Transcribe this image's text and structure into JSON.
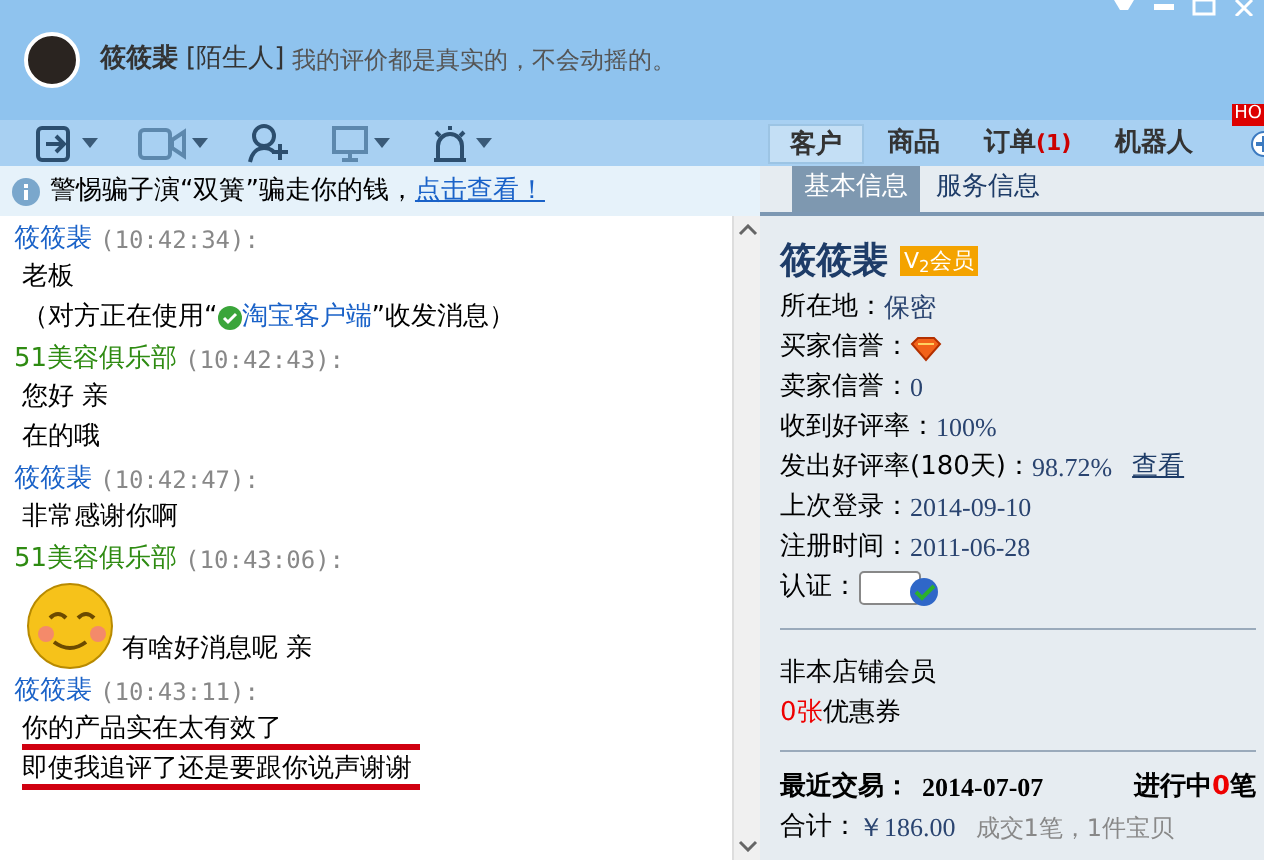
{
  "header": {
    "name": "筱筱裴",
    "relation": "[陌生人]",
    "signature": "我的评价都是真实的，不会动摇的。"
  },
  "top_tabs": [
    {
      "label": "客户",
      "selected": true
    },
    {
      "label": "商品",
      "selected": false
    },
    {
      "label": "订单",
      "badge": "(1)",
      "selected": false
    },
    {
      "label": "机器人",
      "selected": false
    }
  ],
  "hot_badge": "HO",
  "notice": {
    "text": "警惕骗子演“双簧”骗走你的钱，",
    "link": "点击查看！"
  },
  "messages": [
    {
      "sender": "筱筱裴",
      "kind": "customer",
      "time": "(10:42:34):",
      "lines": [
        {
          "text": "老板",
          "underlined": false
        }
      ],
      "client_note": {
        "before": "（对方正在使用“",
        "link": "淘宝客户端",
        "after": "”收发消息）"
      }
    },
    {
      "sender": "51美容俱乐部",
      "kind": "seller",
      "time": "(10:42:43):",
      "lines": [
        {
          "text": "您好 亲",
          "underlined": false
        },
        {
          "text": "在的哦",
          "underlined": false
        }
      ]
    },
    {
      "sender": "筱筱裴",
      "kind": "customer",
      "time": "(10:42:47):",
      "lines": [
        {
          "text": "非常感谢你啊",
          "underlined": false
        }
      ]
    },
    {
      "sender": "51美容俱乐部",
      "kind": "seller",
      "time": "(10:43:06):",
      "emoticon": true,
      "lines": [
        {
          "text": "有啥好消息呢  亲",
          "underlined": false
        }
      ]
    },
    {
      "sender": "筱筱裴",
      "kind": "customer",
      "time": "(10:43:11):",
      "lines": [
        {
          "text": "你的产品实在太有效了",
          "underlined": true
        },
        {
          "text": "即使我追评了还是要跟你说声谢谢",
          "underlined": true
        }
      ]
    }
  ],
  "info_tabs": [
    {
      "label": "基本信息",
      "selected": true
    },
    {
      "label": "服务信息",
      "selected": false
    }
  ],
  "profile": {
    "name": "筱筱裴",
    "vip": "V$_{2}$会员"
  },
  "fields": [
    {
      "label": "所在地：",
      "kind": "text",
      "value": "保密"
    },
    {
      "label": "买家信誉：",
      "kind": "diamond"
    },
    {
      "label": "卖家信誉：",
      "kind": "text",
      "value": "0"
    },
    {
      "label": "收到好评率：",
      "kind": "text",
      "value": "100%"
    },
    {
      "label": "发出好评率(180天)：",
      "kind": "text",
      "value": "98.72%",
      "link": "查看"
    },
    {
      "label": "上次登录：",
      "kind": "text",
      "value": "2014-09-10"
    },
    {
      "label": "注册时间：",
      "kind": "text",
      "value": "2011-06-28"
    },
    {
      "label": "认证：",
      "kind": "cert"
    }
  ],
  "membership": "非本店铺会员",
  "coupons": {
    "count": "0张",
    "label": "优惠券"
  },
  "recent": {
    "label": "最近交易：",
    "date": "2014-07-07",
    "ongoing_label": "进行中",
    "ongoing_count": "0",
    "ongoing_unit": "笔"
  },
  "total": {
    "label": "合计：",
    "amount": "￥186.00",
    "detail": "成交1笔，1件宝贝"
  }
}
